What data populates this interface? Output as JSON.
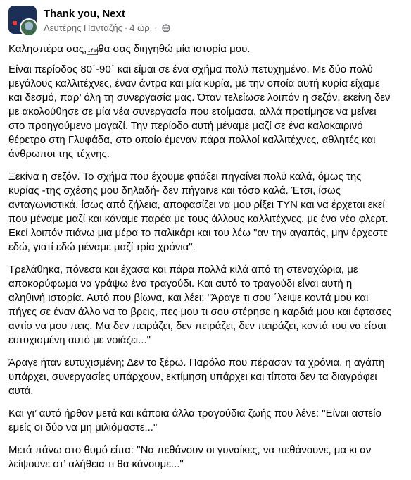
{
  "post": {
    "group_name": "Thank you, Next",
    "author": "Λευτέρης Πανταζής",
    "separator": "·",
    "time": "4 ώρ.",
    "privacy_icon": "globe-icon",
    "greeting_before": "Καλησπέρα σας,",
    "greeting_emoji_code": "1f60a",
    "greeting_after": "θα σας διηγηθώ μία ιστορία μου.",
    "paragraphs": [
      "Είναι περίοδος 80΄-90΄ και είμαι σε ένα σχήμα πολύ πετυχημένο. Με δύο πολύ\nμεγάλους καλλιτέχνες, έναν άντρα και μία κυρία, με την οποία αυτή κυρία είχαμε\nκαι δεσμό, παρ’ όλη τη συνεργασία μας. Όταν τελείωσε λοιπόν η σεζόν, εκείνη δεν\nμε ακολούθησε σε μία νέα συνεργασία που ετοίμασα, αλλά προτίμησε να μείνει\nστο προηγούμενο μαγαζί. Την περίοδο αυτή μέναμε μαζί σε ένα καλοκαιρινό\nθέρετρο στη Γλυφάδα, στο οποίο έμεναν πάρα πολλοί καλλιτέχνες, αθλητές και\nάνθρωποι της τέχνης.",
      "Ξεκίνα η σεζόν. Το σχήμα που έχουμε φτιάξει πηγαίνει πολύ καλά, όμως της\nκυρίας -της σχέσης μου δηλαδή- δεν πήγαινε και τόσο καλά. Έτσι, ίσως\nανταγωνιστικά, ίσως από ζήλεια, αποφασίζει να μου ρίξει ΤΥΝ  και να έρχεται εκεί\nπου μέναμε μαζί και κάναμε παρέα με τους άλλους καλλιτέχνες, με ένα νέο φλερτ.\nΕκεί λοιπόν πιάνω μια μέρα το παλικάρι και του λέω \"αν την αγαπάς, μην έρχεστε\nεδώ, γιατί εδώ μέναμε μαζί τρία χρόνια\".",
      "Τρελάθηκα, πόνεσα και έχασα και πάρα πολλά κιλά από τη στεναχώρια, με\nαποκορύφωμα να γράψω ένα τραγούδι. Και αυτό το τραγούδι είναι αυτή η\nαληθινή ιστορία. Αυτό που βίωνα, και λέει: \"Άραγε τι σου ΄λειψε κοντά μου και\nπήγες σε έναν άλλο να το βρεις, πες μου τι σου στέρησε η καρδιά μου και έφτασες\nαντίο να μου πεις. Μα δεν πειράζει, δεν πειράζει, δεν πειράζει, κοντά του να είσαι\nευτυχισμένη αυτό με νοιάζει...\"",
      "Άραγε ήταν ευτυχισμένη; Δεν το ξέρω. Παρόλο που πέρασαν τα χρόνια, η αγάπη\nυπάρχει, συνεργασίες υπάρχουν, εκτίμηση υπάρχει και τίποτα δεν τα διαγράφει\nαυτά.",
      "Και γι’ αυτό ήρθαν μετά και κάποια άλλα τραγούδια ζωής που λένε: \"Είναι αστείο\nεμείς οι δύο να μη μιλιόμαστε...\"",
      "Μετά πάνω στο θυμό είπα: \"Να πεθάνουν οι γυναίκες, να πεθάνουνε, μα κι αν\nλείψουνε στ’ αλήθεια τι θα κάνουμε...\""
    ]
  }
}
